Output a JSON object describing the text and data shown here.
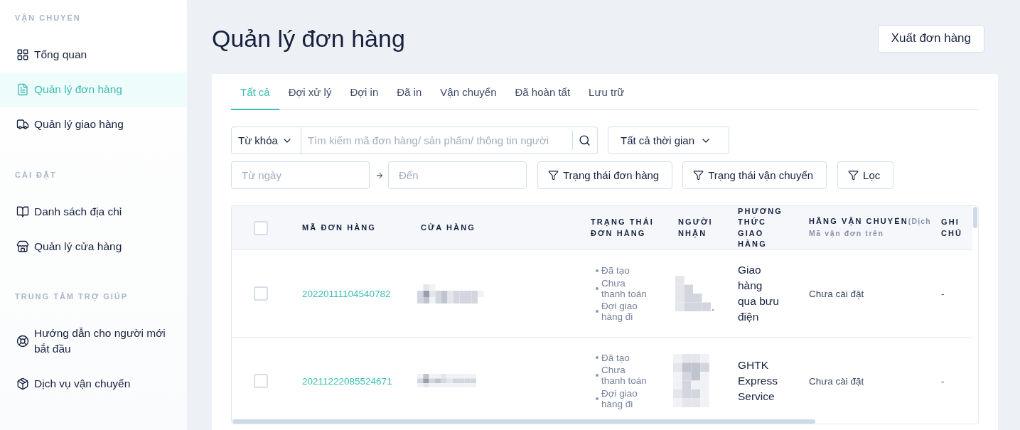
{
  "sidebar": {
    "sections": [
      {
        "title": "VẬN CHUYỂN",
        "items": [
          {
            "label": "Tổng quan",
            "selected": false
          },
          {
            "label": "Quản lý đơn hàng",
            "selected": true
          },
          {
            "label": "Quản lý giao hàng",
            "selected": false
          }
        ]
      },
      {
        "title": "CÀI ĐẶT",
        "items": [
          {
            "label": "Danh sách địa chỉ",
            "selected": false
          },
          {
            "label": "Quản lý cửa hàng",
            "selected": false
          }
        ]
      },
      {
        "title": "TRUNG TÂM TRỢ GIÚP",
        "items": [
          {
            "label": "Hướng dẫn cho người mới bắt đầu",
            "selected": false
          },
          {
            "label": "Dịch vụ vận chuyển",
            "selected": false
          }
        ]
      }
    ]
  },
  "page": {
    "title": "Quản lý đơn hàng",
    "export_button": "Xuất đơn hàng"
  },
  "tabs": [
    {
      "label": "Tất cả",
      "selected": true
    },
    {
      "label": "Đợi xử lý",
      "selected": false
    },
    {
      "label": "Đợi in",
      "selected": false
    },
    {
      "label": "Đã in",
      "selected": false
    },
    {
      "label": "Vận chuyển",
      "selected": false
    },
    {
      "label": "Đã hoàn tất",
      "selected": false
    },
    {
      "label": "Lưu trữ",
      "selected": false
    }
  ],
  "filters": {
    "keyword_select": "Từ khóa",
    "search": {
      "placeholder": "Tìm kiếm mã đơn hàng/ sản phẩm/ thông tin người"
    },
    "time_select": "Tất cả thời gian",
    "date_from": {
      "placeholder": "Từ ngày"
    },
    "date_to": {
      "placeholder": "Đến"
    },
    "filter_buttons": [
      "Trạng thái đơn hàng",
      "Trạng thái vận chuyển",
      "Lọc"
    ]
  },
  "table": {
    "select_all": {
      "checked": false
    },
    "columns": [
      {
        "title": "MÃ ĐƠN HÀNG"
      },
      {
        "title": "CỬA HÀNG"
      },
      {
        "title": "TRẠNG THÁI ĐƠN HÀNG"
      },
      {
        "title": "NGƯỜI NHẬN"
      },
      {
        "title": "PHƯƠNG THỨC GIAO HÀNG"
      },
      {
        "title": "HÃNG VẬN CHUYỂN",
        "title_note": "(Dịch",
        "subtitle": "Mã vận đơn trên"
      },
      {
        "title": "GHI CHÚ"
      }
    ],
    "rows": [
      {
        "checked": false,
        "order_id": "20220111104540782",
        "store_redacted": true,
        "statuses": [
          "Đã tạo",
          "Chưa thanh toán",
          "Đợi giao hàng đi"
        ],
        "recipient_redacted": true,
        "delivery_method": "Giao hàng qua bưu điện",
        "carrier": "Chưa cài đặt",
        "note": "-"
      },
      {
        "checked": false,
        "order_id": "20211222085524671",
        "store_redacted": true,
        "statuses": [
          "Đã tạo",
          "Chưa thanh toán",
          "Đợi giao hàng đi"
        ],
        "recipient_redacted": true,
        "delivery_method": "GHTK Express Service",
        "carrier": "Chưa cài đặt",
        "note": "-"
      }
    ]
  }
}
